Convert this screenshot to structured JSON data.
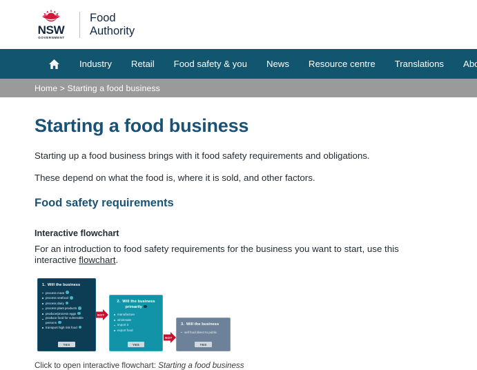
{
  "masthead": {
    "nsw_word": "NSW",
    "nsw_sub": "GOVERNMENT",
    "brand_line_1": "Food",
    "brand_line_2": "Authority",
    "logo_icon": "nsw-waratah-logo"
  },
  "nav": {
    "home_icon": "home-icon",
    "items": [
      {
        "label": "Industry"
      },
      {
        "label": "Retail"
      },
      {
        "label": "Food safety & you"
      },
      {
        "label": "News"
      },
      {
        "label": "Resource centre"
      },
      {
        "label": "Translations"
      },
      {
        "label": "About us"
      }
    ],
    "background": "#11556f"
  },
  "breadcrumb": {
    "text": "Home > Starting a food business",
    "background": "#9a9a9a"
  },
  "main": {
    "page_title": "Starting a food business",
    "paragraph_1": "Starting up a food business brings with it food safety requirements and obligations.",
    "paragraph_2": "These depend on what the food is, where it is sold, and other factors.",
    "section_title": "Food safety requirements",
    "sub_title": "Interactive flowchart",
    "intro_before_link": "For an introduction to food safety requirements for the business you want to start, use this interactive ",
    "intro_link": "flowchart",
    "intro_after_link": ".",
    "heading_color": "#1a5276"
  },
  "flowchart": {
    "caption_prefix": "Click to open interactive flowchart: ",
    "caption_title": "Starting a food business",
    "arrow_label_1": "NO?",
    "arrow_label_2": "NO?",
    "cards": [
      {
        "number": "1.",
        "heading": "Will the business",
        "items": [
          "process meat",
          "process seafood",
          "process dairy",
          "process plant products",
          "produce/process eggs",
          "produce food for vulnerable persons",
          "transport high risk food"
        ],
        "button": "YES",
        "color": "#0d3c55"
      },
      {
        "number": "2.",
        "heading": "Will the business primarily",
        "items": [
          "manufacture",
          "wholesale",
          "import it",
          "export food"
        ],
        "button": "YES",
        "color": "#1193a8"
      },
      {
        "number": "3.",
        "heading": "Will the business",
        "items": [
          "sell food direct to public"
        ],
        "button": "YES",
        "color": "#6d8298"
      }
    ]
  }
}
